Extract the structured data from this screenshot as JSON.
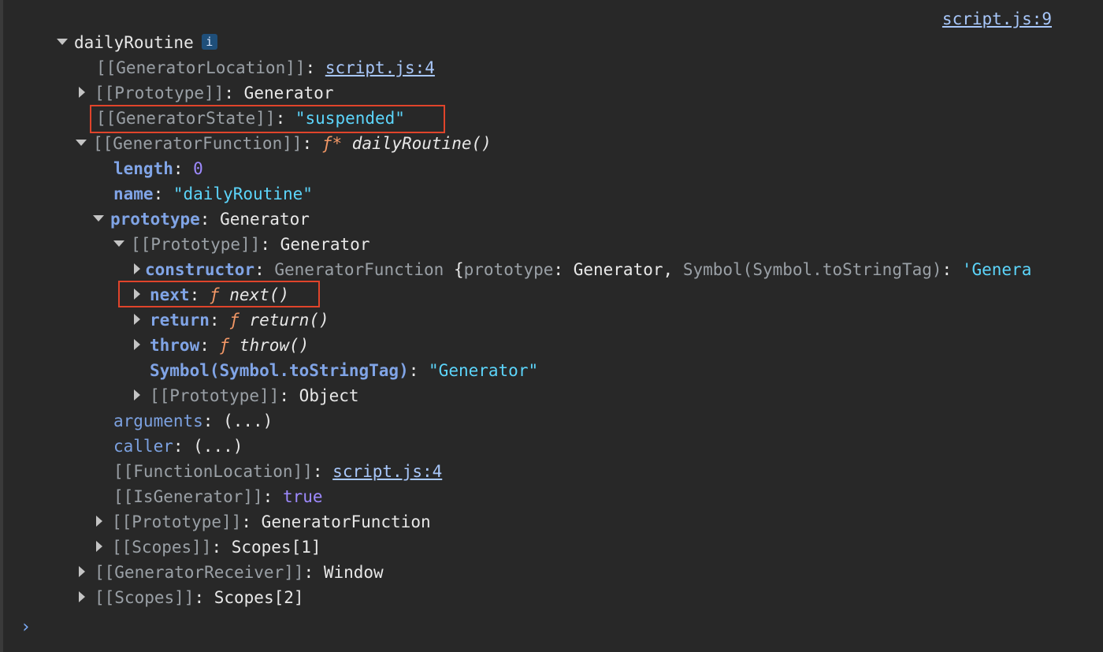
{
  "source_link": "script.js:9",
  "root": {
    "name": "dailyRoutine",
    "info_icon": "i"
  },
  "rows": {
    "gen_location": {
      "key": "[[GeneratorLocation]]",
      "value": "script.js:4"
    },
    "proto": {
      "key": "[[Prototype]]",
      "value": "Generator"
    },
    "gen_state": {
      "key": "[[GeneratorState]]",
      "value": "\"suspended\""
    },
    "gen_function": {
      "key": "[[GeneratorFunction]]",
      "fn_prefix": "ƒ*",
      "value": "dailyRoutine()"
    },
    "length": {
      "key": "length",
      "value": "0"
    },
    "name": {
      "key": "name",
      "value": "\"dailyRoutine\""
    },
    "prototype": {
      "key": "prototype",
      "value": "Generator"
    },
    "proto2": {
      "key": "[[Prototype]]",
      "value": "Generator"
    },
    "constructor": {
      "key": "constructor",
      "value_class": "GeneratorFunction",
      "open": "{",
      "prop1_key": "prototype",
      "prop1_val": "Generator,",
      "prop2_key": "Symbol(Symbol.toStringTag)",
      "prop2_val": "'Genera"
    },
    "next": {
      "key": "next",
      "fn_prefix": "ƒ",
      "value": "next()"
    },
    "return": {
      "key": "return",
      "fn_prefix": "ƒ",
      "value": "return()"
    },
    "throw": {
      "key": "throw",
      "fn_prefix": "ƒ",
      "value": "throw()"
    },
    "symbol_tag": {
      "key": "Symbol(Symbol.toStringTag)",
      "value": "\"Generator\""
    },
    "proto3": {
      "key": "[[Prototype]]",
      "value": "Object"
    },
    "arguments": {
      "key": "arguments",
      "value": "(...)"
    },
    "caller": {
      "key": "caller",
      "value": "(...)"
    },
    "fn_location": {
      "key": "[[FunctionLocation]]",
      "value": "script.js:4"
    },
    "is_generator": {
      "key": "[[IsGenerator]]",
      "value": "true"
    },
    "proto4": {
      "key": "[[Prototype]]",
      "value": "GeneratorFunction"
    },
    "scopes1": {
      "key": "[[Scopes]]",
      "value": "Scopes[1]"
    },
    "gen_receiver": {
      "key": "[[GeneratorReceiver]]",
      "value": "Window"
    },
    "scopes2": {
      "key": "[[Scopes]]",
      "value": "Scopes[2]"
    }
  },
  "prompt_symbol": "›",
  "colors": {
    "background": "#282828",
    "highlight_box": "#e0442b",
    "string": "#5cd5fb",
    "number": "#9e8aff",
    "function_f": "#f29766",
    "link": "#a8c7fa"
  }
}
